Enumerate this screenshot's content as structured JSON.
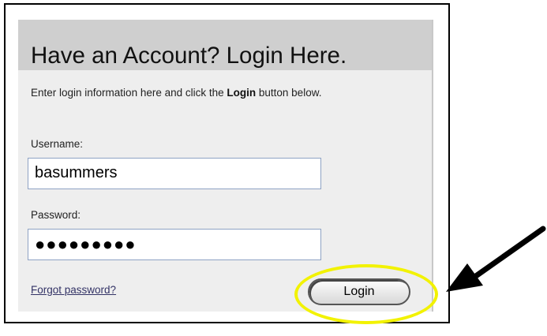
{
  "panel": {
    "title": "Have an Account? Login Here.",
    "instructions_before": "Enter login information here and click the ",
    "instructions_bold": "Login",
    "instructions_after": " button below."
  },
  "username": {
    "label": "Username:",
    "value": "basummers"
  },
  "password": {
    "label": "Password:",
    "value": "●●●●●●●●●"
  },
  "forgot_link": "Forgot password?",
  "login_button": "Login",
  "annotation": {
    "highlight_color": "#f2f200",
    "arrow_color": "#000000"
  }
}
